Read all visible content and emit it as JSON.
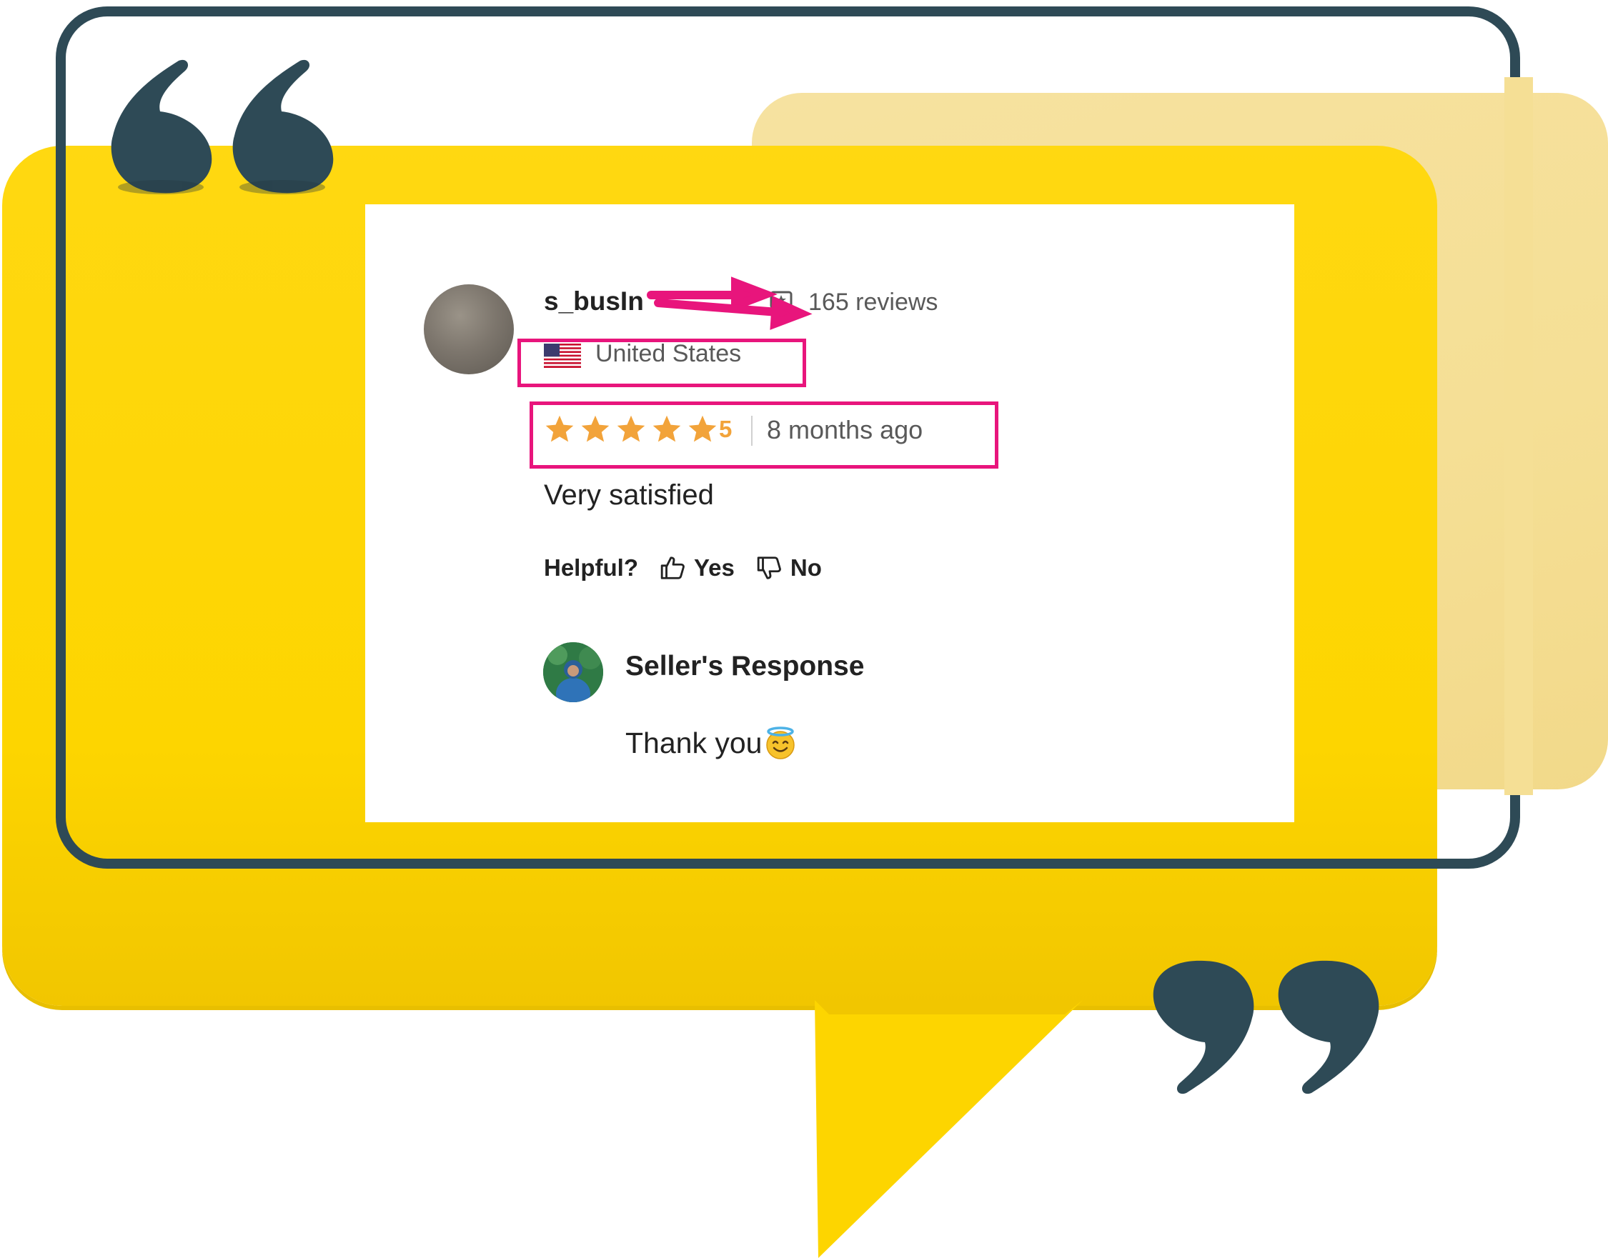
{
  "colors": {
    "yellow": "#fdd500",
    "pale_yellow": "#f5df95",
    "frame_slate": "#2e4a56",
    "highlight_pink": "#e8157c",
    "star_orange": "#f2a33a"
  },
  "review": {
    "username": "s_busIn",
    "review_count": "165 reviews",
    "country": "United States",
    "flag_icon": "us-flag-icon",
    "rating": 5,
    "rating_label": "5",
    "time_ago": "8 months ago",
    "comment": "Very satisfied",
    "helpful_label": "Helpful?",
    "yes_label": "Yes",
    "no_label": "No"
  },
  "seller_response": {
    "title": "Seller's Response",
    "text": "Thank you",
    "emoji_icon": "smiling-face-with-halo-icon"
  }
}
